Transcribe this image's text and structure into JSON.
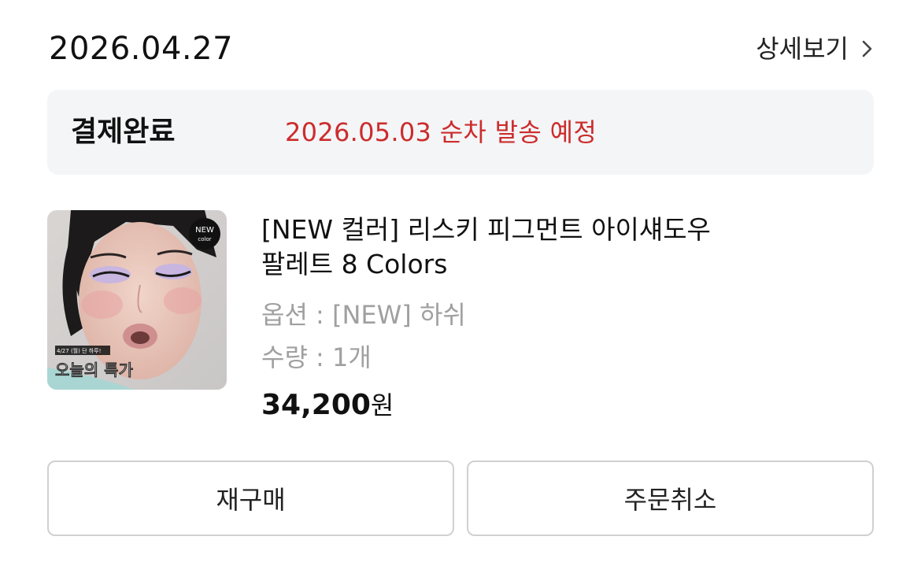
{
  "order": {
    "date": "2026.04.27",
    "detail_label": "상세보기",
    "status": "결제완료",
    "shipping_note": "2026.05.03 순차 발송 예정"
  },
  "product": {
    "name_line1": "[NEW 컬러] 리스키 피그먼트 아이섀도우",
    "name_line2": "팔레트 8 Colors",
    "option": "옵션 : [NEW] 하쉬",
    "quantity": "수량 : 1개",
    "price_amount": "34,200",
    "price_unit": "원",
    "thumbnail": {
      "badge_line1": "NEW",
      "badge_line2": "color",
      "promo_small": "4/27 (월) 단 하루!",
      "promo_big": "오늘의 특가"
    }
  },
  "actions": {
    "reorder_label": "재구매",
    "cancel_label": "주문취소"
  },
  "colors": {
    "shipping_note": "#cc2c2c",
    "status_bg": "#f4f5f7",
    "button_border": "#d0d0d0",
    "muted_text": "#a0a0a0"
  },
  "icons": {
    "detail": "chevron-right-icon"
  }
}
